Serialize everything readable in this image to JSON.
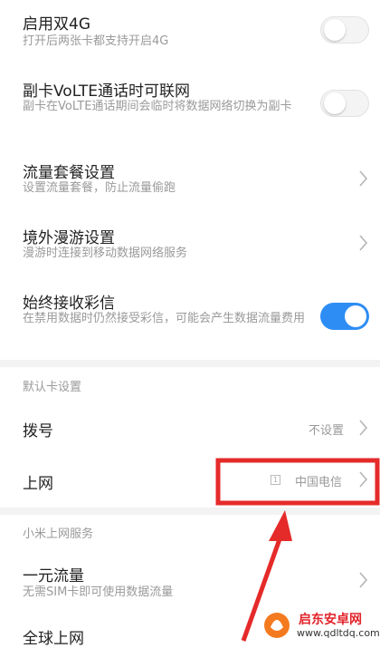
{
  "settings": [
    {
      "title": "启用双4G",
      "subtitle": "打开后两张卡都支持开启4G",
      "toggle": "off"
    },
    {
      "title": "副卡VoLTE通话时可联网",
      "subtitle": "副卡在VoLTE通话期间会临时将数据网络切换为副卡",
      "toggle": "off"
    },
    {
      "title": "流量套餐设置",
      "subtitle": "设置流量套餐，防止流量偷跑"
    },
    {
      "title": "境外漫游设置",
      "subtitle": "漫游时连接到移动数据网络服务"
    },
    {
      "title": "始终接收彩信",
      "subtitle": "在禁用数据时仍然接受彩信，可能会产生数据流量费用",
      "toggle": "on"
    }
  ],
  "default_card": {
    "section_label": "默认卡设置",
    "dial": {
      "title": "拨号",
      "value": "不设置"
    },
    "internet": {
      "title": "上网",
      "sim_number": "1",
      "value": "中国电信"
    }
  },
  "mi_service": {
    "section_label": "小米上网服务",
    "one_yuan": {
      "title": "一元流量",
      "subtitle": "无需SIM卡即可使用数据流量"
    },
    "global": {
      "title": "全球上网"
    }
  },
  "watermark": {
    "site": "启东安卓网",
    "url": "www.qdltdq.com"
  },
  "colors": {
    "accent": "#2e8df5",
    "annotation": "#e52a2a"
  }
}
